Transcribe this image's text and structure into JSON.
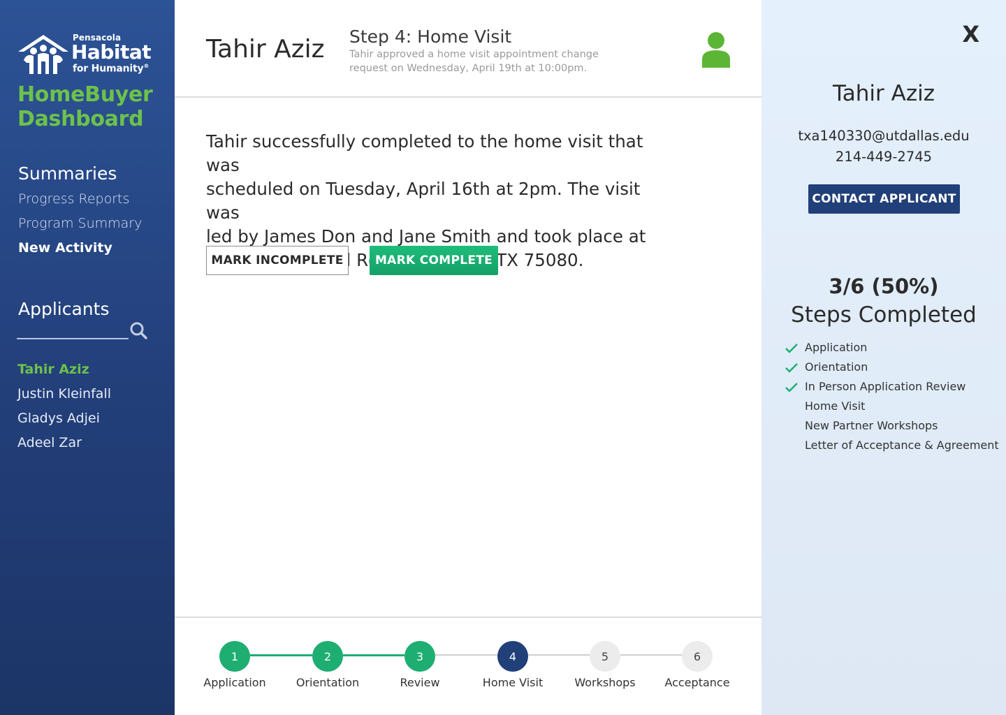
{
  "sidebar": {
    "logo": {
      "small": "Pensacola",
      "big": "Habitat",
      "sub": "for Humanity",
      "mark": "®"
    },
    "title_line1": "HomeBuyer",
    "title_line2": "Dashboard",
    "summaries_heading": "Summaries",
    "summary_links": [
      "Progress Reports",
      "Program Summary",
      "New Activity"
    ],
    "applicants_heading": "Applicants",
    "applicants": [
      "Tahir Aziz",
      "Justin Kleinfall",
      "Gladys Adjei",
      "Adeel Zar"
    ]
  },
  "main": {
    "header": {
      "name": "Tahir Aziz",
      "step": "Step 4: Home Visit",
      "subtitle": "Tahir approved a home visit appointment change request on  Wednesday, April 19th at 10:00pm."
    },
    "body_lines": [
      "Tahir successfully completed to the home visit that was",
      "scheduled on Tuesday, April 16th at 2pm. The visit was",
      "led by James Don and Jane Smith and took place at",
      "800 W. Cambpell Rd. Richardson, TX 75080."
    ],
    "mark_incomplete": "MARK INCOMPLETE",
    "mark_complete": "MARK COMPLETE"
  },
  "progress": {
    "steps": [
      {
        "num": "1",
        "label": "Application",
        "status": "done"
      },
      {
        "num": "2",
        "label": "Orientation",
        "status": "done"
      },
      {
        "num": "3",
        "label": "Review",
        "status": "done"
      },
      {
        "num": "4",
        "label": "Home Visit",
        "status": "current"
      },
      {
        "num": "5",
        "label": "Workshops",
        "status": "todo"
      },
      {
        "num": "6",
        "label": "Acceptance",
        "status": "todo"
      }
    ]
  },
  "right": {
    "close": "X",
    "name": "Tahir Aziz",
    "email": "txa140330@utdallas.edu",
    "phone": "214-449-2745",
    "contact_button": "CONTACT APPLICANT",
    "count": "3/6 (50%)",
    "steps_title": "Steps Completed",
    "steps": [
      {
        "label": "Application",
        "done": true
      },
      {
        "label": "Orientation",
        "done": true
      },
      {
        "label": "In Person Application Review",
        "done": true
      },
      {
        "label": "Home Visit",
        "done": false
      },
      {
        "label": "New Partner Workshops",
        "done": false
      },
      {
        "label": "Letter of Acceptance & Agreement",
        "done": false
      }
    ]
  },
  "colors": {
    "brand_green": "#6cc24a",
    "done_green": "#1eae72",
    "current_blue": "#213f79",
    "todo_gray": "#ececec",
    "sidebar_blue": "#2c5396"
  },
  "icons": {
    "search": "search-icon",
    "user": "user-icon",
    "close": "close-icon",
    "check": "check-icon",
    "logo": "habitat-logo"
  }
}
